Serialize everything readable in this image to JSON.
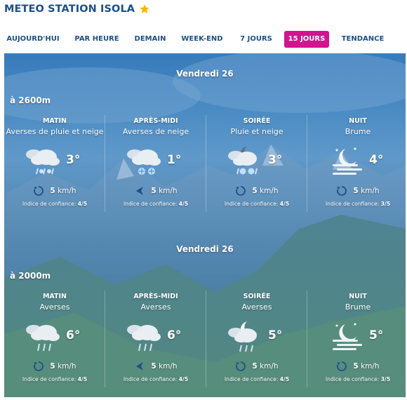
{
  "header": {
    "title": "METEO STATION ISOLA"
  },
  "tabs": [
    {
      "label": "AUJOURD'HUI",
      "active": false
    },
    {
      "label": "PAR HEURE",
      "active": false
    },
    {
      "label": "DEMAIN",
      "active": false
    },
    {
      "label": "WEEK-END",
      "active": false
    },
    {
      "label": "7 JOURS",
      "active": false
    },
    {
      "label": "15 JOURS",
      "active": true
    },
    {
      "label": "TENDANCE",
      "active": false
    }
  ],
  "sections": [
    {
      "day": "Vendredi 26",
      "altitude": "à 2600m",
      "periods": [
        {
          "name": "MATIN",
          "desc": "Averses de pluie et neige",
          "temp": "3°",
          "wind": "5",
          "unit": "km/h",
          "conf_label": "Indice de confiance:",
          "conf": "4/5",
          "icon": "rain-snow-cloud-icon"
        },
        {
          "name": "APRÈS-MIDI",
          "desc": "Averses de neige",
          "temp": "1°",
          "wind": "5",
          "unit": "km/h",
          "conf_label": "Indice de confiance:",
          "conf": "4/5",
          "icon": "snow-cloud-icon"
        },
        {
          "name": "SOIRÉE",
          "desc": "Pluie et neige",
          "temp": "3°",
          "wind": "5",
          "unit": "km/h",
          "conf_label": "Indice de confiance:",
          "conf": "4/5",
          "icon": "night-rain-snow-icon"
        },
        {
          "name": "NUIT",
          "desc": "Brume",
          "temp": "4°",
          "wind": "5",
          "unit": "km/h",
          "conf_label": "Indice de confiance:",
          "conf": "3/5",
          "icon": "night-mist-icon"
        }
      ]
    },
    {
      "day": "Vendredi 26",
      "altitude": "à 2000m",
      "periods": [
        {
          "name": "MATIN",
          "desc": "Averses",
          "temp": "6°",
          "wind": "5",
          "unit": "km/h",
          "conf_label": "Indice de confiance:",
          "conf": "4/5",
          "icon": "rain-cloud-icon"
        },
        {
          "name": "APRÈS-MIDI",
          "desc": "Averses",
          "temp": "6°",
          "wind": "5",
          "unit": "km/h",
          "conf_label": "Indice de confiance:",
          "conf": "4/5",
          "icon": "rain-cloud-icon"
        },
        {
          "name": "SOIRÉE",
          "desc": "Averses",
          "temp": "5°",
          "wind": "5",
          "unit": "km/h",
          "conf_label": "Indice de confiance:",
          "conf": "4/5",
          "icon": "night-rain-icon"
        },
        {
          "name": "NUIT",
          "desc": "Brume",
          "temp": "5°",
          "wind": "5",
          "unit": "km/h",
          "conf_label": "Indice de confiance:",
          "conf": "3/5",
          "icon": "night-mist-icon"
        }
      ]
    }
  ],
  "colors": {
    "brand": "#1d4f88",
    "active_tab": "#d3138f",
    "star": "#f5b800"
  }
}
